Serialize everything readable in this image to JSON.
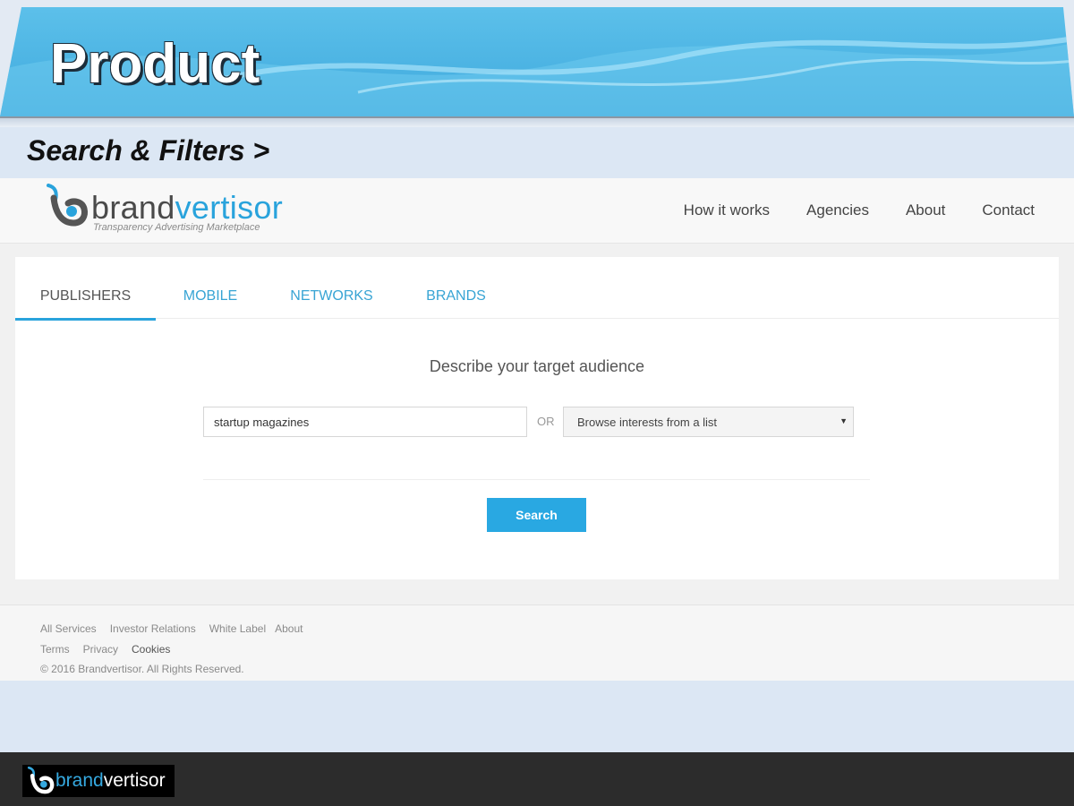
{
  "slide": {
    "title": "Product",
    "subtitle": "Search & Filters >"
  },
  "site": {
    "logo": {
      "text_main": "brand",
      "text_accent": "vertisor",
      "tagline": "Transparency Advertising Marketplace",
      "icon": "brandvertisor-b-logo-icon"
    },
    "nav": {
      "items": [
        {
          "label": "How it works"
        },
        {
          "label": "Agencies"
        },
        {
          "label": "About"
        },
        {
          "label": "Contact"
        }
      ]
    },
    "tabs": [
      {
        "label": "PUBLISHERS",
        "active": true
      },
      {
        "label": "MOBILE",
        "active": false
      },
      {
        "label": "NETWORKS",
        "active": false
      },
      {
        "label": "BRANDS",
        "active": false
      }
    ],
    "search": {
      "prompt": "Describe your target audience",
      "input_value": "startup magazines",
      "or_label": "OR",
      "select_value": "Browse interests from a list",
      "button_label": "Search"
    },
    "footer": {
      "row1": [
        "All Services",
        "Investor Relations",
        "White Label",
        "About"
      ],
      "row2": [
        "Terms",
        "Privacy",
        "Cookies"
      ],
      "copyright": "© 2016 Brandvertisor. All Rights Reserved."
    }
  },
  "bottom_bar": {
    "logo_main": "brand",
    "logo_accent": "vertisor"
  },
  "colors": {
    "accent": "#29a3dc",
    "button": "#29a8e2",
    "banner": "#4db6e6",
    "bottom_bar": "#2c2c2c"
  }
}
